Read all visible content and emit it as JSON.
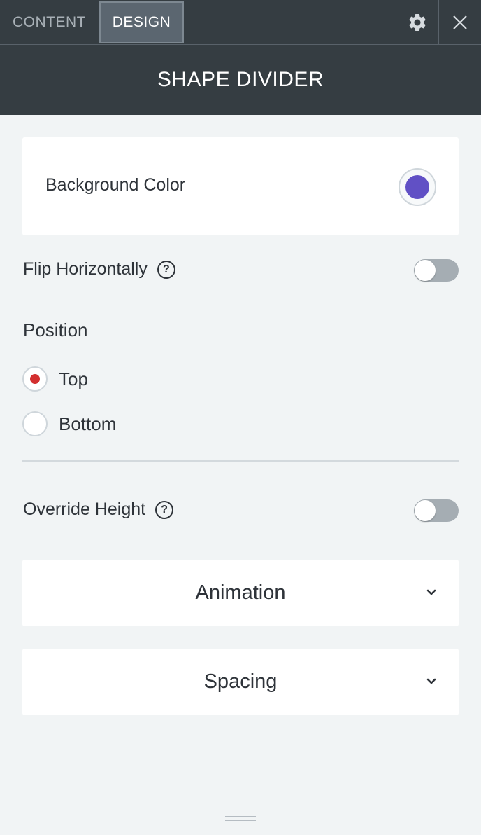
{
  "tabs": {
    "content_label": "CONTENT",
    "design_label": "DESIGN"
  },
  "header": {
    "title": "SHAPE DIVIDER"
  },
  "background_color": {
    "label": "Background Color",
    "value": "#6150c5"
  },
  "flip_horizontally": {
    "label": "Flip Horizontally",
    "help": "?",
    "enabled": false
  },
  "position": {
    "title": "Position",
    "options": [
      {
        "label": "Top",
        "selected": true
      },
      {
        "label": "Bottom",
        "selected": false
      }
    ]
  },
  "override_height": {
    "label": "Override Height",
    "help": "?",
    "enabled": false
  },
  "sections": {
    "animation_label": "Animation",
    "spacing_label": "Spacing"
  },
  "icons": {
    "settings": "gear-icon",
    "close": "close-icon",
    "help": "help-icon",
    "expand": "chevron-down-icon",
    "resize": "resize-handle-icon"
  },
  "colors": {
    "header_bg": "#353d42",
    "active_tab_bg": "#5b6670",
    "panel_bg": "#f1f4f5",
    "radio_selected": "#d32f2f",
    "toggle_off": "#a5adb3"
  }
}
